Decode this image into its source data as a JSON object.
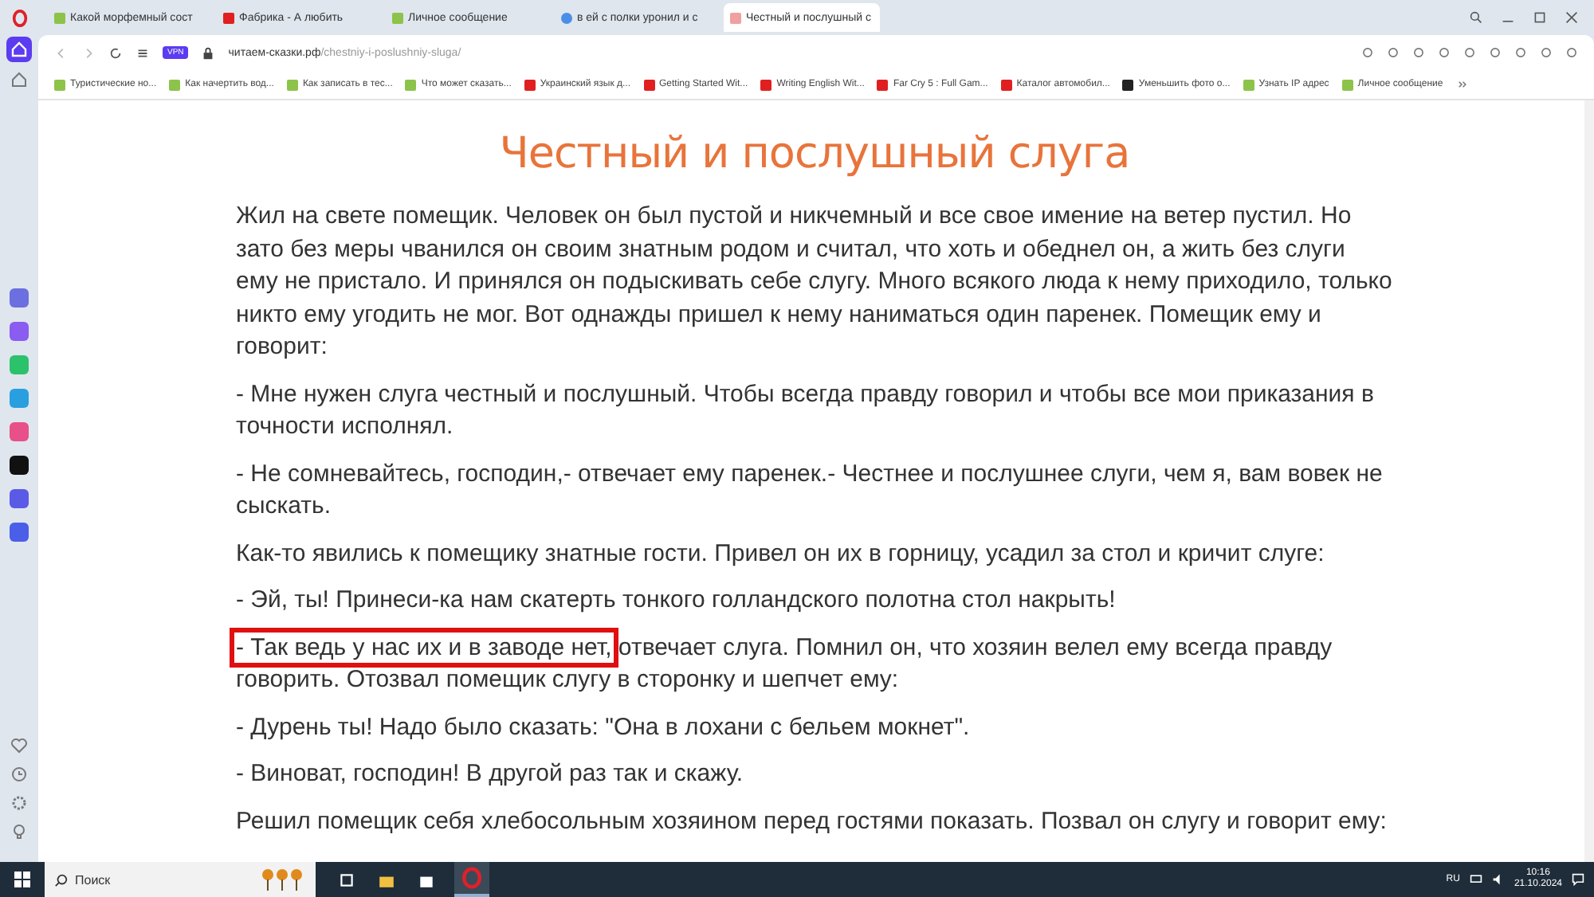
{
  "tabs": [
    {
      "label": "Какой морфемный сост",
      "kind": "site",
      "selected": false
    },
    {
      "label": "Фабрика - А любить",
      "kind": "video",
      "selected": false
    },
    {
      "label": "Личное сообщение",
      "kind": "site",
      "selected": false
    },
    {
      "label": "в ей с полки уронил и с",
      "kind": "search",
      "selected": false
    },
    {
      "label": "Честный и послушный с",
      "kind": "book",
      "selected": true
    }
  ],
  "address": {
    "domain": "читаем-сказки.рф",
    "path": "/chestniy-i-poslushniy-sluga/",
    "badge": "VPN"
  },
  "bookmarks": [
    {
      "label": "Туристические но...",
      "kind": "site"
    },
    {
      "label": "Как начертить вод...",
      "kind": "site"
    },
    {
      "label": "Как записать в тес...",
      "kind": "site"
    },
    {
      "label": "Что может сказать...",
      "kind": "site"
    },
    {
      "label": "Украинский язык д...",
      "kind": "video"
    },
    {
      "label": "Getting Started Wit...",
      "kind": "video"
    },
    {
      "label": "Writing English Wit...",
      "kind": "video"
    },
    {
      "label": "Far Cry 5 : Full Gam...",
      "kind": "video"
    },
    {
      "label": "Каталог автомобил...",
      "kind": "video"
    },
    {
      "label": "Уменьшить фото о...",
      "kind": "grid"
    },
    {
      "label": "Узнать IP адрес",
      "kind": "site"
    },
    {
      "label": "Личное сообщение",
      "kind": "site"
    }
  ],
  "article": {
    "title": "Честный и послушный слуга",
    "paragraphs": [
      {
        "text": "Жил на свете помещик. Человек он был пустой и никчемный и все свое имение на ветер пустил. Но зато без меры чванился он своим знатным родом и считал, что хоть и обеднел он, а жить без слуги ему не пристало. И принялся он подыскивать себе слугу. Много всякого люда к нему приходило, только никто ему угодить не мог. Вот однажды пришел к нему наниматься один паренек. Помещик ему и говорит:"
      },
      {
        "text": "- Мне нужен слуга честный и послушный. Чтобы всегда правду говорил и чтобы все мои приказания в точности исполнял."
      },
      {
        "text": "- Не сомневайтесь, господин,- отвечает ему паренек.- Честнее и послушнее слуги, чем я, вам вовек не сыскать."
      },
      {
        "text": "Как-то явились к помещику знатные гости. Привел он их в горницу, усадил за стол и кричит слуге:"
      },
      {
        "text": "- Эй, ты! Принеси-ка нам скатерть тонкого голландского полотна стол накрыть!"
      },
      {
        "highlight": "- Так ведь у нас их и в заводе нет,",
        "text": " отвечает слуга. Помнил он, что хозяин велел ему всегда правду говорить. Отозвал помещик слугу в сторонку и шепчет ему:"
      },
      {
        "text": "- Дурень ты! Надо было сказать: \"Она в лохани с бельем мокнет\"."
      },
      {
        "text": "- Виноват, господин! В другой раз так и скажу."
      },
      {
        "text": "Решил помещик себя хлебосольным хозяином перед гостями показать. Позвал он слугу и говорит ему:"
      }
    ]
  },
  "taskbar": {
    "search_placeholder": "Поиск",
    "language": "RU",
    "time": "10:16",
    "date": "21.10.2024"
  }
}
